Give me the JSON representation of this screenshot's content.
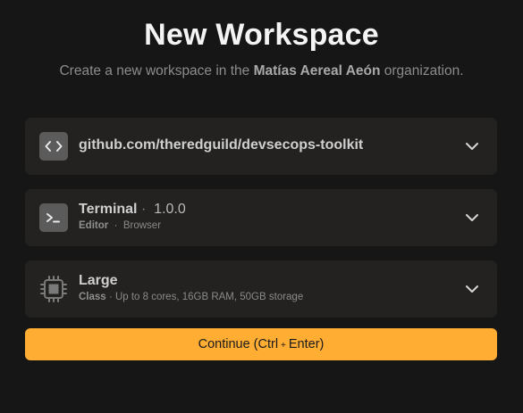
{
  "header": {
    "title": "New Workspace",
    "subtitle_prefix": "Create a new workspace in the ",
    "organization": "Matías Aereal Aeón",
    "subtitle_suffix": " organization."
  },
  "repository": {
    "value": "github.com/theredguild/devsecops-toolkit",
    "icon": "code-brackets-icon"
  },
  "editor": {
    "name": "Terminal",
    "separator": "·",
    "version": "1.0.0",
    "label": "Editor",
    "sub_separator": "·",
    "type": "Browser",
    "icon": "terminal-icon"
  },
  "workspace_class": {
    "name": "Large",
    "label": "Class",
    "sub_separator": "·",
    "description": "Up to 8 cores, 16GB RAM, 50GB storage",
    "icon": "cpu-chip-icon"
  },
  "continue_button": {
    "label_start": "Continue (Ctrl",
    "plus": "+",
    "label_end": "Enter)"
  },
  "colors": {
    "background": "#161616",
    "card": "#232220",
    "accent": "#ffad33"
  }
}
